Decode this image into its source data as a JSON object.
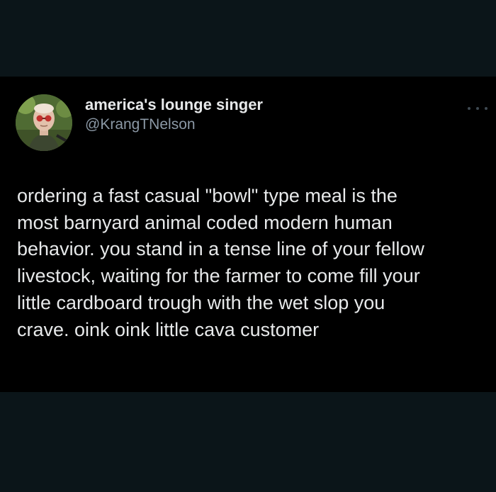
{
  "tweet": {
    "author": {
      "display_name": "america's lounge singer",
      "handle": "@KrangTNelson"
    },
    "text": "ordering a fast casual \"bowl\" type meal is the\nmost barnyard animal coded modern human\nbehavior. you stand in a tense line of your fellow\nlivestock, waiting for the farmer to come fill your\nlittle cardboard trough with the wet slop you\ncrave. oink oink little cava customer",
    "more_icon": "more-horizontal-icon"
  },
  "colors": {
    "page_background": "#0b1519",
    "card_background": "#000000",
    "primary_text": "#e7e9ea",
    "secondary_text": "#8b98a5"
  }
}
